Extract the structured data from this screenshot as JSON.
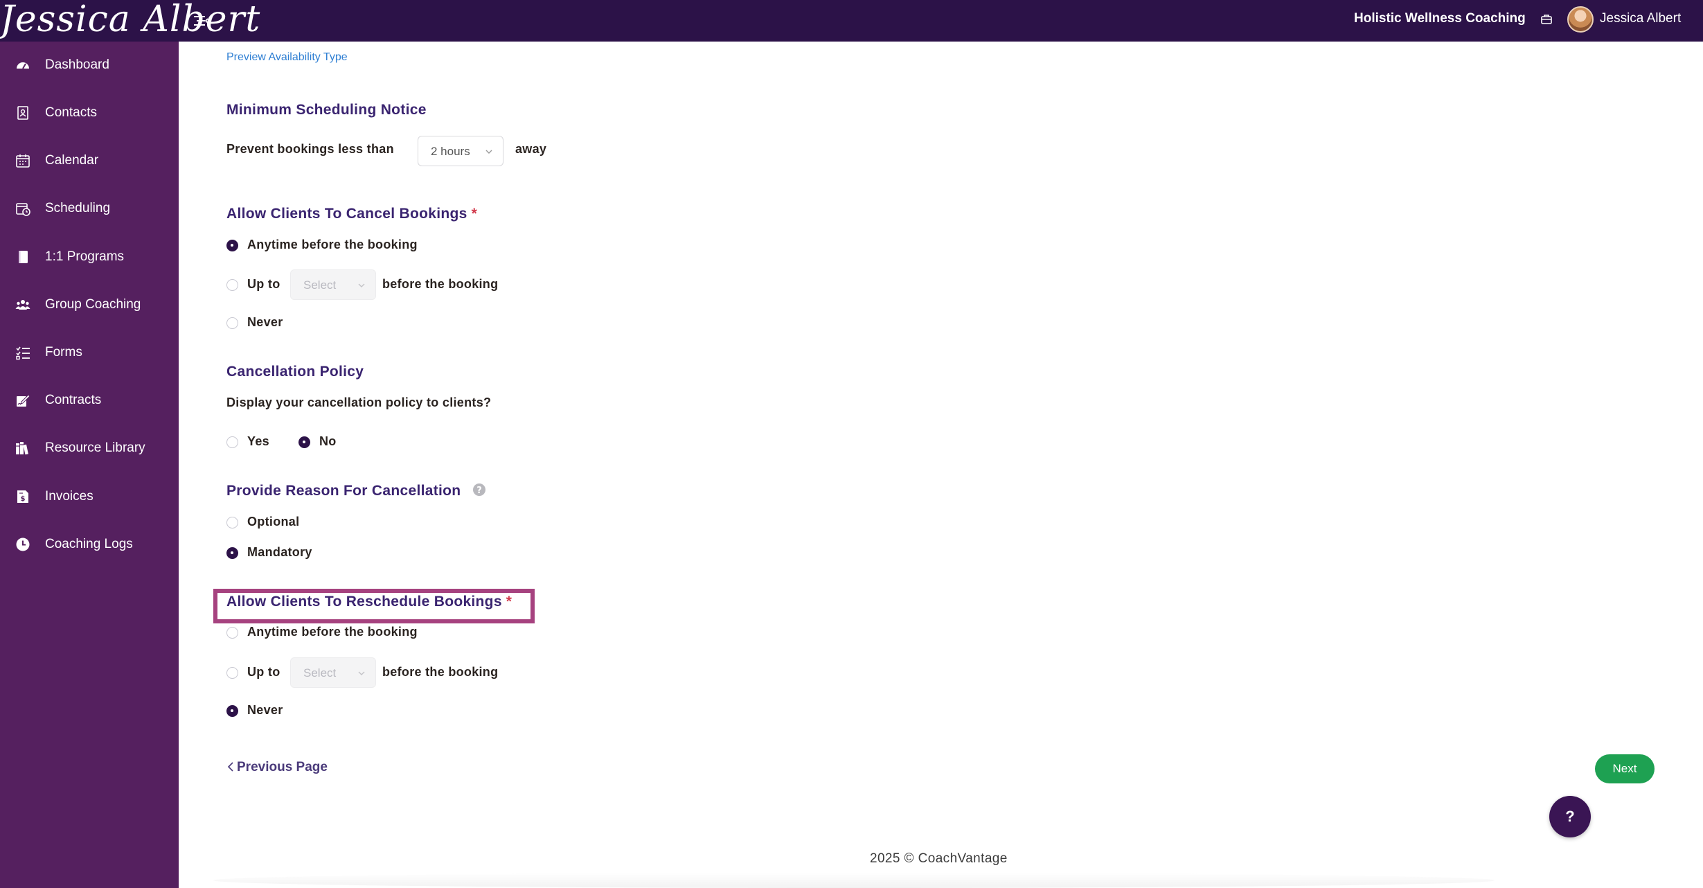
{
  "header": {
    "brand": "Jessica Albert",
    "org_name": "Holistic Wellness Coaching",
    "user_name": "Jessica Albert"
  },
  "sidebar": {
    "items": [
      {
        "label": "Dashboard",
        "icon": "dashboard-gauge-icon"
      },
      {
        "label": "Contacts",
        "icon": "contacts-book-icon"
      },
      {
        "label": "Calendar",
        "icon": "calendar-icon"
      },
      {
        "label": "Scheduling",
        "icon": "calendar-clock-icon"
      },
      {
        "label": "1:1 Programs",
        "icon": "book-icon"
      },
      {
        "label": "Group Coaching",
        "icon": "users-group-icon"
      },
      {
        "label": "Forms",
        "icon": "checklist-icon"
      },
      {
        "label": "Contracts",
        "icon": "signature-icon"
      },
      {
        "label": "Resource Library",
        "icon": "books-icon"
      },
      {
        "label": "Invoices",
        "icon": "invoice-icon"
      },
      {
        "label": "Coaching Logs",
        "icon": "clock-icon"
      }
    ]
  },
  "main": {
    "preview_link": "Preview Availability Type",
    "min_notice": {
      "title": "Minimum Scheduling Notice",
      "prefix": "Prevent bookings less than",
      "selected": "2 hours",
      "suffix": "away"
    },
    "cancel": {
      "title": "Allow Clients To Cancel Bookings",
      "required_mark": "*",
      "opt_anytime": "Anytime before the booking",
      "opt_upto": "Up to",
      "select_placeholder": "Select",
      "opt_upto_suffix": "before the booking",
      "opt_never": "Never",
      "selected": "anytime"
    },
    "policy": {
      "title": "Cancellation Policy",
      "question": "Display your cancellation policy to clients?",
      "opt_yes": "Yes",
      "opt_no": "No",
      "selected": "no"
    },
    "reason": {
      "title": "Provide Reason For Cancellation",
      "opt_optional": "Optional",
      "opt_mandatory": "Mandatory",
      "selected": "mandatory"
    },
    "reschedule": {
      "title": "Allow Clients To Reschedule Bookings",
      "required_mark": "*",
      "opt_anytime": "Anytime before the booking",
      "opt_upto": "Up to",
      "select_placeholder": "Select",
      "opt_upto_suffix": "before the booking",
      "opt_never": "Never",
      "selected": "never"
    },
    "prev_page": "Previous Page",
    "next": "Next",
    "help": "?"
  },
  "footer": {
    "text": "2025 © CoachVantage"
  },
  "colors": {
    "topbar": "#2c1248",
    "sidebar": "#55205f",
    "title": "#3a2470",
    "highlight": "#a6427f",
    "next_button": "#1ea152",
    "required": "#d23a4c",
    "link": "#2f7fd3"
  }
}
